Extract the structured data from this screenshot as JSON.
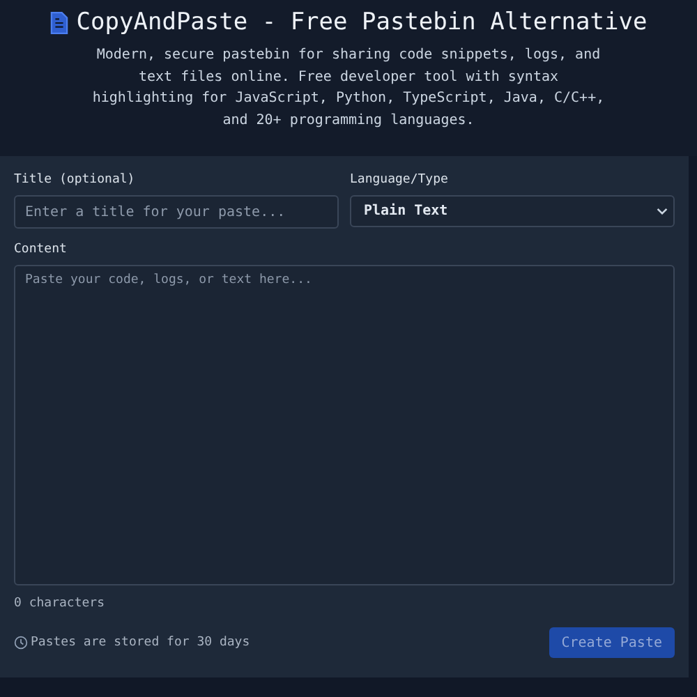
{
  "header": {
    "title": "CopyAndPaste - Free Pastebin Alternative",
    "description": "Modern, secure pastebin for sharing code snippets, logs, and text files online. Free developer tool with syntax highlighting for JavaScript, Python, TypeScript, Java, C/C++, and 20+ programming languages."
  },
  "form": {
    "title_field": {
      "label": "Title (optional)",
      "placeholder": "Enter a title for your paste..."
    },
    "language_field": {
      "label": "Language/Type",
      "value": "Plain Text"
    },
    "content_field": {
      "label": "Content",
      "placeholder": "Paste your code, logs, or text here..."
    },
    "char_count": "0 characters",
    "retention_note": "Pastes are stored for 30 days",
    "submit_button": {
      "label": "Create Paste",
      "disabled": true
    }
  }
}
